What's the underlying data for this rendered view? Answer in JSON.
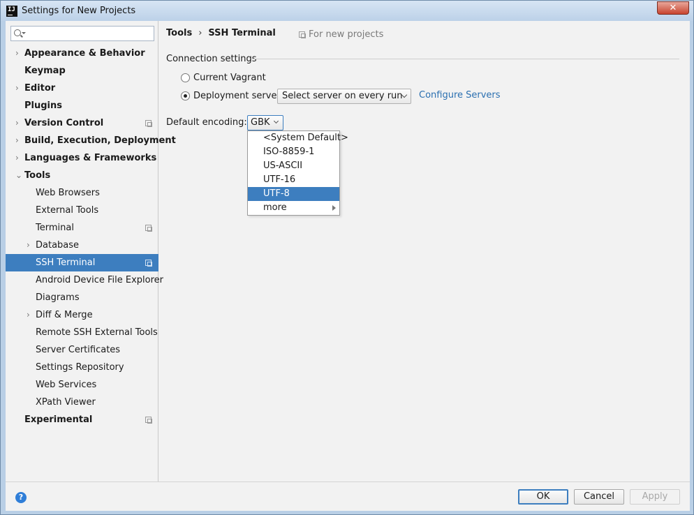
{
  "window": {
    "title": "Settings for New Projects",
    "close_label": "✕"
  },
  "sidebar": {
    "search": {
      "value": "",
      "placeholder": ""
    },
    "items": [
      {
        "label": "Appearance & Behavior",
        "bold": true,
        "arrow": "›",
        "level": 0
      },
      {
        "label": "Keymap",
        "bold": true,
        "level": 0
      },
      {
        "label": "Editor",
        "bold": true,
        "arrow": "›",
        "level": 0
      },
      {
        "label": "Plugins",
        "bold": true,
        "level": 0
      },
      {
        "label": "Version Control",
        "bold": true,
        "arrow": "›",
        "level": 0,
        "copy_icon": true
      },
      {
        "label": "Build, Execution, Deployment",
        "bold": true,
        "arrow": "›",
        "level": 0
      },
      {
        "label": "Languages & Frameworks",
        "bold": true,
        "arrow": "›",
        "level": 0
      },
      {
        "label": "Tools",
        "bold": true,
        "arrow": "⌄",
        "level": 0
      },
      {
        "label": "Web Browsers",
        "level": 1
      },
      {
        "label": "External Tools",
        "level": 1
      },
      {
        "label": "Terminal",
        "level": 1,
        "copy_icon": true
      },
      {
        "label": "Database",
        "arrow": "›",
        "level": 1
      },
      {
        "label": "SSH Terminal",
        "level": 1,
        "copy_icon": true,
        "selected": true
      },
      {
        "label": "Android Device File Explorer",
        "level": 1
      },
      {
        "label": "Diagrams",
        "level": 1
      },
      {
        "label": "Diff & Merge",
        "arrow": "›",
        "level": 1
      },
      {
        "label": "Remote SSH External Tools",
        "level": 1
      },
      {
        "label": "Server Certificates",
        "level": 1
      },
      {
        "label": "Settings Repository",
        "level": 1
      },
      {
        "label": "Web Services",
        "level": 1
      },
      {
        "label": "XPath Viewer",
        "level": 1
      },
      {
        "label": "Experimental",
        "bold": true,
        "level": 0,
        "copy_icon": true
      }
    ]
  },
  "content": {
    "breadcrumb": {
      "parent": "Tools",
      "separator": "›",
      "current": "SSH Terminal"
    },
    "scope_label": "For new projects",
    "connection": {
      "section_title": "Connection settings",
      "option_vagrant": "Current Vagrant",
      "option_deployment": "Deployment server",
      "selected_option": "deployment",
      "server_select_value": "Select server on every run",
      "configure_link": "Configure Servers"
    },
    "encoding": {
      "label": "Default encoding:",
      "value": "GBK",
      "options": [
        {
          "label": "<System Default>",
          "selected": false
        },
        {
          "label": "ISO-8859-1",
          "selected": false
        },
        {
          "label": "US-ASCII",
          "selected": false
        },
        {
          "label": "UTF-16",
          "selected": false
        },
        {
          "label": "UTF-8",
          "selected": true
        },
        {
          "label": "more",
          "selected": false,
          "submenu": true
        }
      ]
    }
  },
  "footer": {
    "help_label": "?",
    "ok_label": "OK",
    "cancel_label": "Cancel",
    "apply_label": "Apply"
  },
  "colors": {
    "selection": "#3d7ebf",
    "link": "#2a6fb0",
    "background": "#f2f2f2"
  }
}
